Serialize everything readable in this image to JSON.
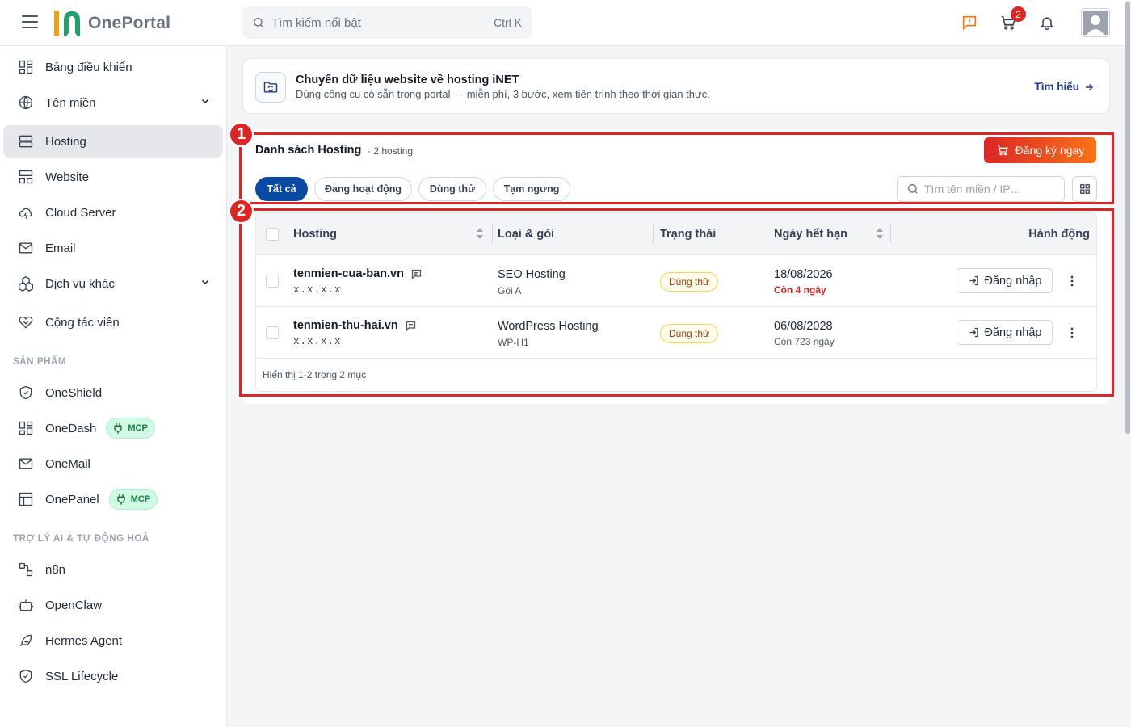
{
  "app": {
    "name": "OnePortal"
  },
  "search": {
    "placeholder": "Tìm kiếm nổi bật",
    "shortcut": "Ctrl K"
  },
  "header": {
    "cart_count": "2"
  },
  "sidebar": {
    "items": [
      {
        "label": "Bảng điều khiển",
        "icon": "dashboard-icon"
      },
      {
        "label": "Tên miền",
        "icon": "globe-icon",
        "expandable": true
      },
      {
        "label": "Hosting",
        "icon": "server-icon",
        "active": true
      },
      {
        "label": "Website",
        "icon": "layout-icon"
      },
      {
        "label": "Cloud Server",
        "icon": "cloud-icon"
      },
      {
        "label": "Email",
        "icon": "mail-icon"
      },
      {
        "label": "Dịch vụ khác",
        "icon": "boxes-icon",
        "expandable": true
      },
      {
        "label": "Cộng tác viên",
        "icon": "handshake-icon"
      }
    ],
    "products_title": "SẢN PHẨM",
    "products": [
      {
        "label": "OneShield",
        "icon": "shield-icon"
      },
      {
        "label": "OneDash",
        "icon": "dashboard-icon",
        "badge": "MCP"
      },
      {
        "label": "OneMail",
        "icon": "mail-icon"
      },
      {
        "label": "OnePanel",
        "icon": "panel-icon",
        "badge": "MCP"
      }
    ],
    "ai_title": "TRỢ LÝ AI & TỰ ĐỘNG HOÁ",
    "ai_items": [
      {
        "label": "n8n",
        "icon": "workflow-icon"
      },
      {
        "label": "OpenClaw",
        "icon": "robot-icon"
      },
      {
        "label": "Hermes Agent",
        "icon": "feather-icon"
      },
      {
        "label": "SSL Lifecycle",
        "icon": "shield-check-icon"
      }
    ]
  },
  "banner": {
    "title": "Chuyển dữ liệu website về hosting iNET",
    "description": "Dùng công cụ có sẵn trong portal — miễn phí, 3 bước, xem tiến trình theo thời gian thực.",
    "link": "Tìm hiểu"
  },
  "hosting_list": {
    "title": "Danh sách Hosting",
    "count": "· 2 hosting",
    "register_button": "Đăng ký ngay",
    "filters": [
      "Tất cả",
      "Đang hoạt động",
      "Dùng thử",
      "Tạm ngưng"
    ],
    "active_filter": "Tất cả",
    "filter_placeholder": "Tìm tên miền / IP…",
    "columns": [
      "Hosting",
      "Loại & gói",
      "Trạng thái",
      "Ngày hết hạn",
      "Hành động"
    ],
    "rows": [
      {
        "domain": "tenmien-cua-ban.vn",
        "ip": "x.x.x.x",
        "type": "SEO Hosting",
        "plan": "Gói A",
        "status": "Dùng thử",
        "expiry": "18/08/2026",
        "remaining": "Còn 4 ngày",
        "remaining_warning": true,
        "action": "Đăng nhập"
      },
      {
        "domain": "tenmien-thu-hai.vn",
        "ip": "x.x.x.x",
        "type": "WordPress Hosting",
        "plan": "WP-H1",
        "status": "Dùng thử",
        "expiry": "06/08/2028",
        "remaining": "Còn 723 ngày",
        "remaining_warning": false,
        "action": "Đăng nhập"
      }
    ],
    "footer": "Hiển thị 1-2 trong 2 mục"
  },
  "annotations": [
    "1",
    "2"
  ],
  "colors": {
    "accent": "#0b4aa2",
    "danger": "#dc2626",
    "brand_orange": "#f97316",
    "callout": "#dc2626"
  }
}
